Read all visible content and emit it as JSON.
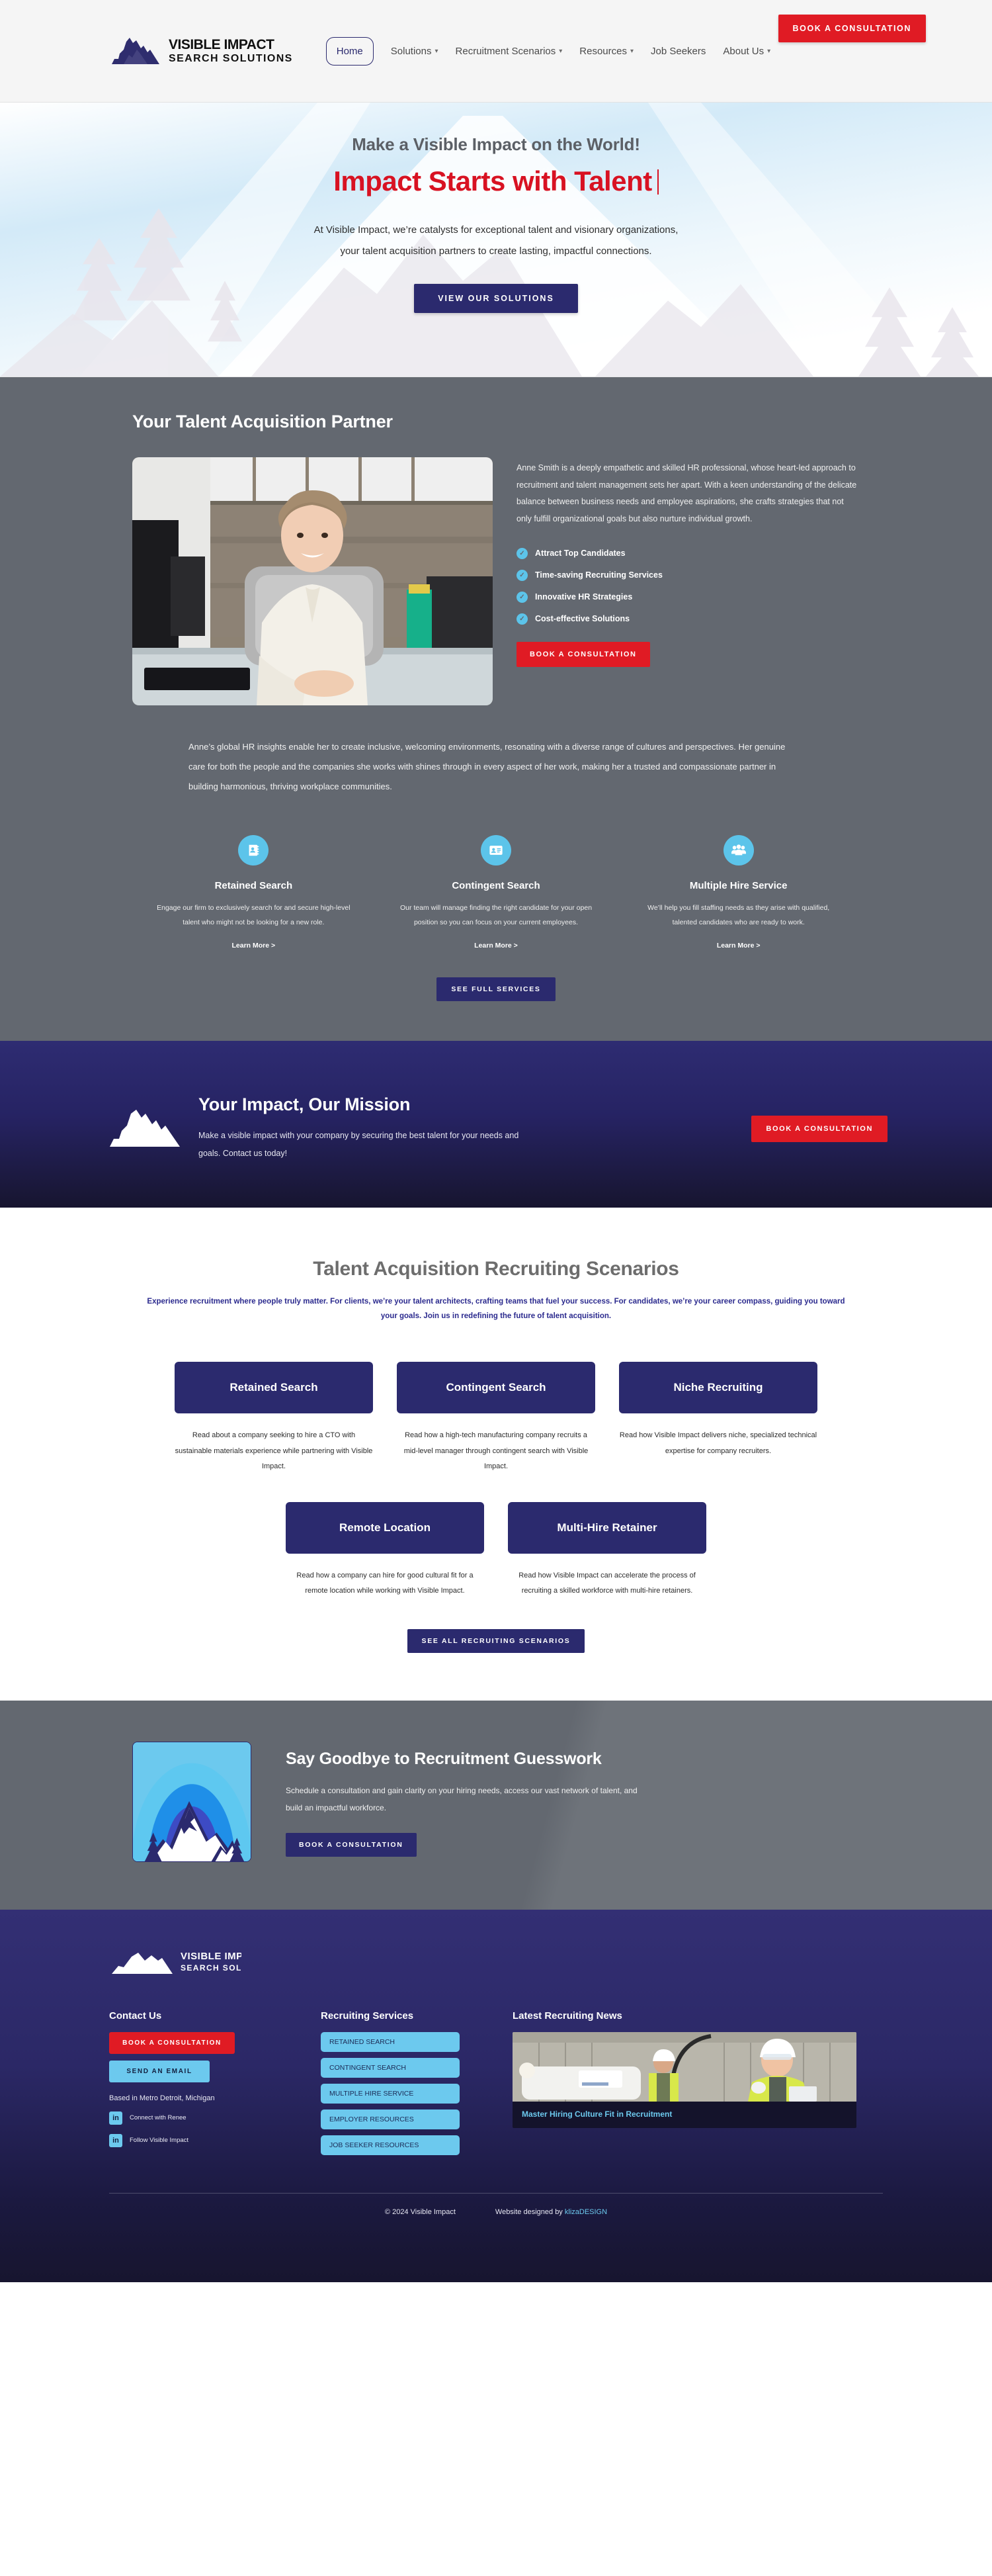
{
  "brand": {
    "name_line1": "VISIBLE IMPACT",
    "name_line2": "SEARCH SOLUTIONS"
  },
  "header": {
    "nav": [
      {
        "label": "Home",
        "caret": "",
        "active": true
      },
      {
        "label": "Solutions",
        "caret": "⌄",
        "active": false
      },
      {
        "label": "Recruitment Scenarios",
        "caret": "⌄",
        "active": false
      },
      {
        "label": "Resources",
        "caret": "⌄",
        "active": false
      },
      {
        "label": "Job Seekers",
        "caret": "",
        "active": false
      },
      {
        "label": "About Us",
        "caret": "⌄",
        "active": false
      }
    ],
    "cta": "BOOK A CONSULTATION"
  },
  "hero": {
    "kicker": "Make a Visible Impact on the World!",
    "title": "Impact Starts with Talent",
    "sub_line1": "At Visible Impact, we’re catalysts for exceptional talent and visionary organizations,",
    "sub_line2": "your talent acquisition partners to create lasting, impactful connections.",
    "cta": "VIEW OUR SOLUTIONS"
  },
  "partner": {
    "heading": "Your Talent Acquisition Partner",
    "bio": "Anne Smith is a deeply empathetic and skilled HR professional, whose heart-led approach to recruitment and talent management sets her apart. With a keen understanding of the delicate balance between business needs and employee aspirations, she crafts strategies that not only fulfill organizational goals but also nurture individual growth.",
    "checklist": [
      "Attract Top Candidates",
      "Time-saving Recruiting Services",
      "Innovative HR Strategies",
      "Cost-effective Solutions"
    ],
    "cta": "BOOK A CONSULTATION",
    "paragraph": "Anne’s global HR insights enable her to create inclusive, welcoming environments, resonating with a diverse range of cultures and perspectives. Her genuine care for both the people and the companies she works with shines through in every aspect of her work, making her a trusted and compassionate partner in building harmonious, thriving workplace communities.",
    "services": [
      {
        "icon": "contact-book-icon",
        "title": "Retained Search",
        "desc": "Engage our firm to exclusively search for and secure high-level talent who might not be looking for a new role.",
        "link": "Learn More >"
      },
      {
        "icon": "id-card-icon",
        "title": "Contingent Search",
        "desc": "Our team will manage finding the right candidate for your open position so you can focus on your current employees.",
        "link": "Learn More >"
      },
      {
        "icon": "people-group-icon",
        "title": "Multiple Hire Service",
        "desc": "We’ll help you fill staffing needs as they arise with qualified, talented candidates who are ready to work.",
        "link": "Learn More >"
      }
    ],
    "full_services_cta": "SEE FULL SERVICES"
  },
  "mission": {
    "heading": "Your Impact, Our Mission",
    "body": "Make a visible impact with your company by securing the best talent for your needs and goals. Contact us today!",
    "cta": "BOOK A CONSULTATION"
  },
  "scenarios": {
    "heading": "Talent Acquisition Recruiting Scenarios",
    "lede": "Experience recruitment where people truly matter. For clients, we’re your talent architects, crafting teams that fuel your success. For candidates, we’re your career compass, guiding you toward your goals. Join us in redefining the future of talent acquisition.",
    "row1": [
      {
        "title": "Retained Search",
        "desc": "Read about a company seeking to hire a CTO with sustainable materials experience while partnering with Visible Impact."
      },
      {
        "title": "Contingent Search",
        "desc": "Read how a high-tech manufacturing company recruits a mid-level manager through contingent search with Visible Impact."
      },
      {
        "title": "Niche Recruiting",
        "desc": "Read how Visible Impact delivers niche, specialized technical expertise for company recruiters."
      }
    ],
    "row2": [
      {
        "title": "Remote Location",
        "desc": "Read how a company can hire for good cultural fit for a remote location while working with Visible Impact."
      },
      {
        "title": "Multi-Hire Retainer",
        "desc": "Read how Visible Impact can accelerate the process of recruiting a skilled workforce with multi-hire retainers."
      }
    ],
    "cta": "SEE ALL RECRUITING SCENARIOS"
  },
  "guesswork": {
    "heading": "Say Goodbye to Recruitment Guesswork",
    "body": "Schedule a consultation and gain clarity on your hiring needs, access our vast network of talent, and build an impactful workforce.",
    "cta": "BOOK A CONSULTATION"
  },
  "footer": {
    "contact": {
      "heading": "Contact Us",
      "cta_primary": "BOOK A CONSULTATION",
      "cta_secondary": "SEND AN EMAIL",
      "location": "Based in Metro Detroit, Michigan",
      "social": [
        {
          "icon": "linkedin-icon",
          "label": "Connect with Renee"
        },
        {
          "icon": "linkedin-icon",
          "label": "Follow Visible Impact"
        }
      ]
    },
    "services": {
      "heading": "Recruiting Services",
      "items": [
        "RETAINED SEARCH",
        "CONTINGENT SEARCH",
        "MULTIPLE HIRE SERVICE",
        "EMPLOYER RESOURCES",
        "JOB SEEKER RESOURCES"
      ]
    },
    "news": {
      "heading": "Latest Recruiting News",
      "article_title": "Master Hiring Culture Fit in Recruitment"
    },
    "copyright": "© 2024 Visible Impact",
    "credit_prefix": "Website designed by ",
    "credit_link": "klizaDESIGN"
  },
  "colors": {
    "navy": "#2b2a6e",
    "red": "#e01b24",
    "sky": "#6cc9ee",
    "gray": "#636870"
  }
}
